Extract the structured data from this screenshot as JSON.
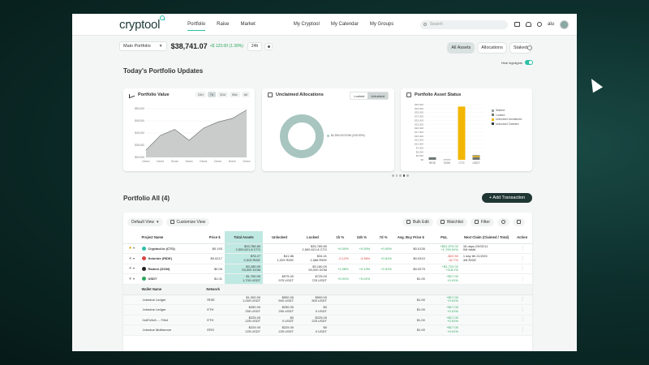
{
  "nav": {
    "logo": "cryptool",
    "links": [
      "Portfolio",
      "Raise",
      "Market",
      "My Cryptool",
      "My Calendar",
      "My Groups"
    ],
    "search_placeholder": "Search",
    "user": "alu"
  },
  "portfolio": {
    "selector": "Main Portfolio",
    "total": "$38,741.07",
    "change": "+$ 123.00 (1.39%)",
    "period": "24h",
    "views": [
      "All Assets",
      "Allocations",
      "Staked"
    ],
    "hide_highlights": "Hide highlights"
  },
  "updates_title": "Today's Portfolio Updates",
  "colors": {
    "accent": "#2cc0a8",
    "positive": "#2aa55a",
    "negative": "#d64545",
    "bar": "#f2b705",
    "dark": "#1f3633"
  },
  "cards": {
    "value": {
      "title": "Portfolio Value",
      "ranges": [
        "24h",
        "7d",
        "30d",
        "90d",
        "All"
      ],
      "active_range": "7d"
    },
    "unclaimed": {
      "title": "Unclaimed Allocations",
      "toggle": [
        "Locked",
        "Unlocked"
      ],
      "active": "Unlocked",
      "legend": "$1,500.00 DOM (100.00%)"
    },
    "status": {
      "title": "Portfolio Asset Status",
      "legend": [
        "Staked",
        "Locked",
        "Unlocked Unclaimed",
        "Unlocked Claimed"
      ],
      "legend_colors": [
        "#9aa3a2",
        "#6f7776",
        "#f2b705",
        "#2f3a39"
      ]
    }
  },
  "chart_data": [
    {
      "type": "area",
      "title": "Portfolio Value",
      "x": [
        "Dxxxx",
        "Dxxxx",
        "Dxxxx",
        "Dxxxx",
        "Dxxxx",
        "Dxxxx",
        "Dxxxx",
        "Dxxxx"
      ],
      "values": [
        33000,
        39000,
        41500,
        37000,
        42000,
        44500,
        46000,
        49500
      ],
      "yticks": [
        "$50,000",
        "$45,000",
        "$40,000",
        "$35,000",
        "$30,000"
      ],
      "ylim": [
        30000,
        50000
      ]
    },
    {
      "type": "pie",
      "title": "Unclaimed Allocations",
      "slices": [
        {
          "label": "DOM",
          "value": 100
        }
      ]
    },
    {
      "type": "bar",
      "title": "Portfolio Asset Status",
      "categories": [
        "RIDE",
        "DOM",
        "CTO",
        "USDT"
      ],
      "series": [
        {
          "name": "Staked",
          "values": [
            0,
            0,
            0,
            0
          ]
        },
        {
          "name": "Locked",
          "values": [
            1000,
            200,
            0,
            1700
          ]
        },
        {
          "name": "Unlocked Unclaimed",
          "values": [
            0,
            0,
            33785,
            800
          ]
        },
        {
          "name": "Unlocked Claimed",
          "values": [
            400,
            0,
            0,
            300
          ]
        }
      ],
      "yticks": [
        "$35,000",
        "$32,500",
        "$30,000",
        "$27,500",
        "$25,000",
        "$22,500",
        "$20,000",
        "$17,500",
        "$15,000",
        "$12,500",
        "$10,000",
        "$7,500",
        "$5,000",
        "$2,500",
        "$0"
      ],
      "ylim": [
        0,
        35000
      ]
    }
  ],
  "table_section": {
    "title": "Portfolio All (4)",
    "add_button": "+ Add Transaction",
    "default_view": "Default View",
    "customize": "Customize View",
    "bulk_edit": "Bulk Edit",
    "watchlist": "Watchlist",
    "filter": "Filter",
    "columns": [
      "Project Name",
      "Price $",
      "Total Assets",
      "Unlocked",
      "Locked",
      "1h %",
      "24h %",
      "7d %",
      "Avg. Buy Price $",
      "P&L",
      "Next Claim (Claimed / Total)",
      "Action"
    ],
    "rows": [
      {
        "name": "Cryptool.io (CTO)",
        "price": "$0.193",
        "total": [
          "$33,785.80",
          "2,500,621.8 CTO"
        ],
        "unlocked": "",
        "locked": [
          "$33,785.80",
          "2,500,621.8 CTO"
        ],
        "h1": "+0.00%",
        "h24": "+0.00%",
        "d7": "+0.00%",
        "avg": "$0.0135",
        "pnl": [
          "+$31,570.02",
          "+1,799.04%"
        ],
        "claim": [
          "16 days 23/02/11",
          "0/6 fdsfd"
        ],
        "star": true,
        "coin": "#2cc0a8"
      },
      {
        "name": "Holoride (RIDE)",
        "price": "$0.0217",
        "total": [
          "$76.27",
          "3,515 RIDE"
        ],
        "unlocked": [
          "$41.86",
          "1,929 RIDE"
        ],
        "locked": [
          "$34.41",
          "1,586 RIDE"
        ],
        "h1": "-0.12%",
        "h24": "-3.38%",
        "d7": "+0.51%",
        "avg": "$0.0310",
        "pnl": [
          "-$22.50",
          "-32.7%"
        ],
        "claim": [
          "1 day 8h 21/2/03",
          "4/8 RIDE"
        ],
        "star": false,
        "coin": "#d64545"
      },
      {
        "name": "Radom (DOM)",
        "price": "$0.06",
        "total": [
          "$3,180.00",
          "53,000 DOM"
        ],
        "unlocked": "",
        "locked": [
          "$3,180.00",
          "53,000 DOM"
        ],
        "h1": "+1.08%",
        "h24": "+0.13%",
        "d7": "+2.51%",
        "avg": "$0.0275",
        "pnl": [
          "+$1,722.02",
          "+118.1%"
        ],
        "claim": "",
        "star": false,
        "coin": "#222222"
      },
      {
        "name": "USDT",
        "price": "$1.01",
        "total": [
          "$1,700.00",
          "1,700 USDT"
        ],
        "unlocked": [
          "$975.00",
          "975 USDT"
        ],
        "locked": [
          "$725.00",
          "725 USDT"
        ],
        "h1": "+0.01%",
        "h24": "+0.01%",
        "d7": "",
        "avg": "$1.00",
        "pnl": [
          "+$17.00",
          "+0.01%"
        ],
        "claim": "",
        "star": false,
        "coin": "#2aa55a"
      }
    ],
    "sub_columns": [
      "Wallet Name",
      "Network"
    ],
    "sub_rows": [
      {
        "wallet": "Johndoe Ledger",
        "network": "RISE",
        "total": [
          "$1,000.00",
          "1,000 USDT"
        ],
        "unlocked": [
          "$500.00",
          "500 USDT"
        ],
        "locked": [
          "$500.00",
          "500 USDT"
        ],
        "avg": "$1.00",
        "pnl": [
          "+$17.00",
          "+0.01%"
        ]
      },
      {
        "wallet": "Johndoe Ledger",
        "network": "ETH",
        "total": [
          "$250.00",
          "250 USDT"
        ],
        "unlocked": [
          "$250.00",
          "250 USDT"
        ],
        "locked": [
          "$0",
          "0 USDT"
        ],
        "avg": "$1.00",
        "pnl": [
          "+$17.00",
          "+0.01%"
        ]
      },
      {
        "wallet": "0x87c9c5.....79b4",
        "network": "ETH",
        "total": [
          "$225.00",
          "225 USDT"
        ],
        "unlocked": [
          "$0",
          "0 USDT"
        ],
        "locked": [
          "$225.00",
          "225 USDT"
        ],
        "avg": "$1.00",
        "pnl": [
          "+$17.00",
          "+0.01%"
        ]
      },
      {
        "wallet": "Johndoe Multisenze",
        "network": "ERO",
        "total": [
          "$225.00",
          "225 USDT"
        ],
        "unlocked": [
          "$225.00",
          "225 USDT"
        ],
        "locked": [
          "$0",
          "0 USDT"
        ],
        "avg": "$1.00",
        "pnl": [
          "+$17.00",
          "+0.01%"
        ]
      }
    ]
  }
}
